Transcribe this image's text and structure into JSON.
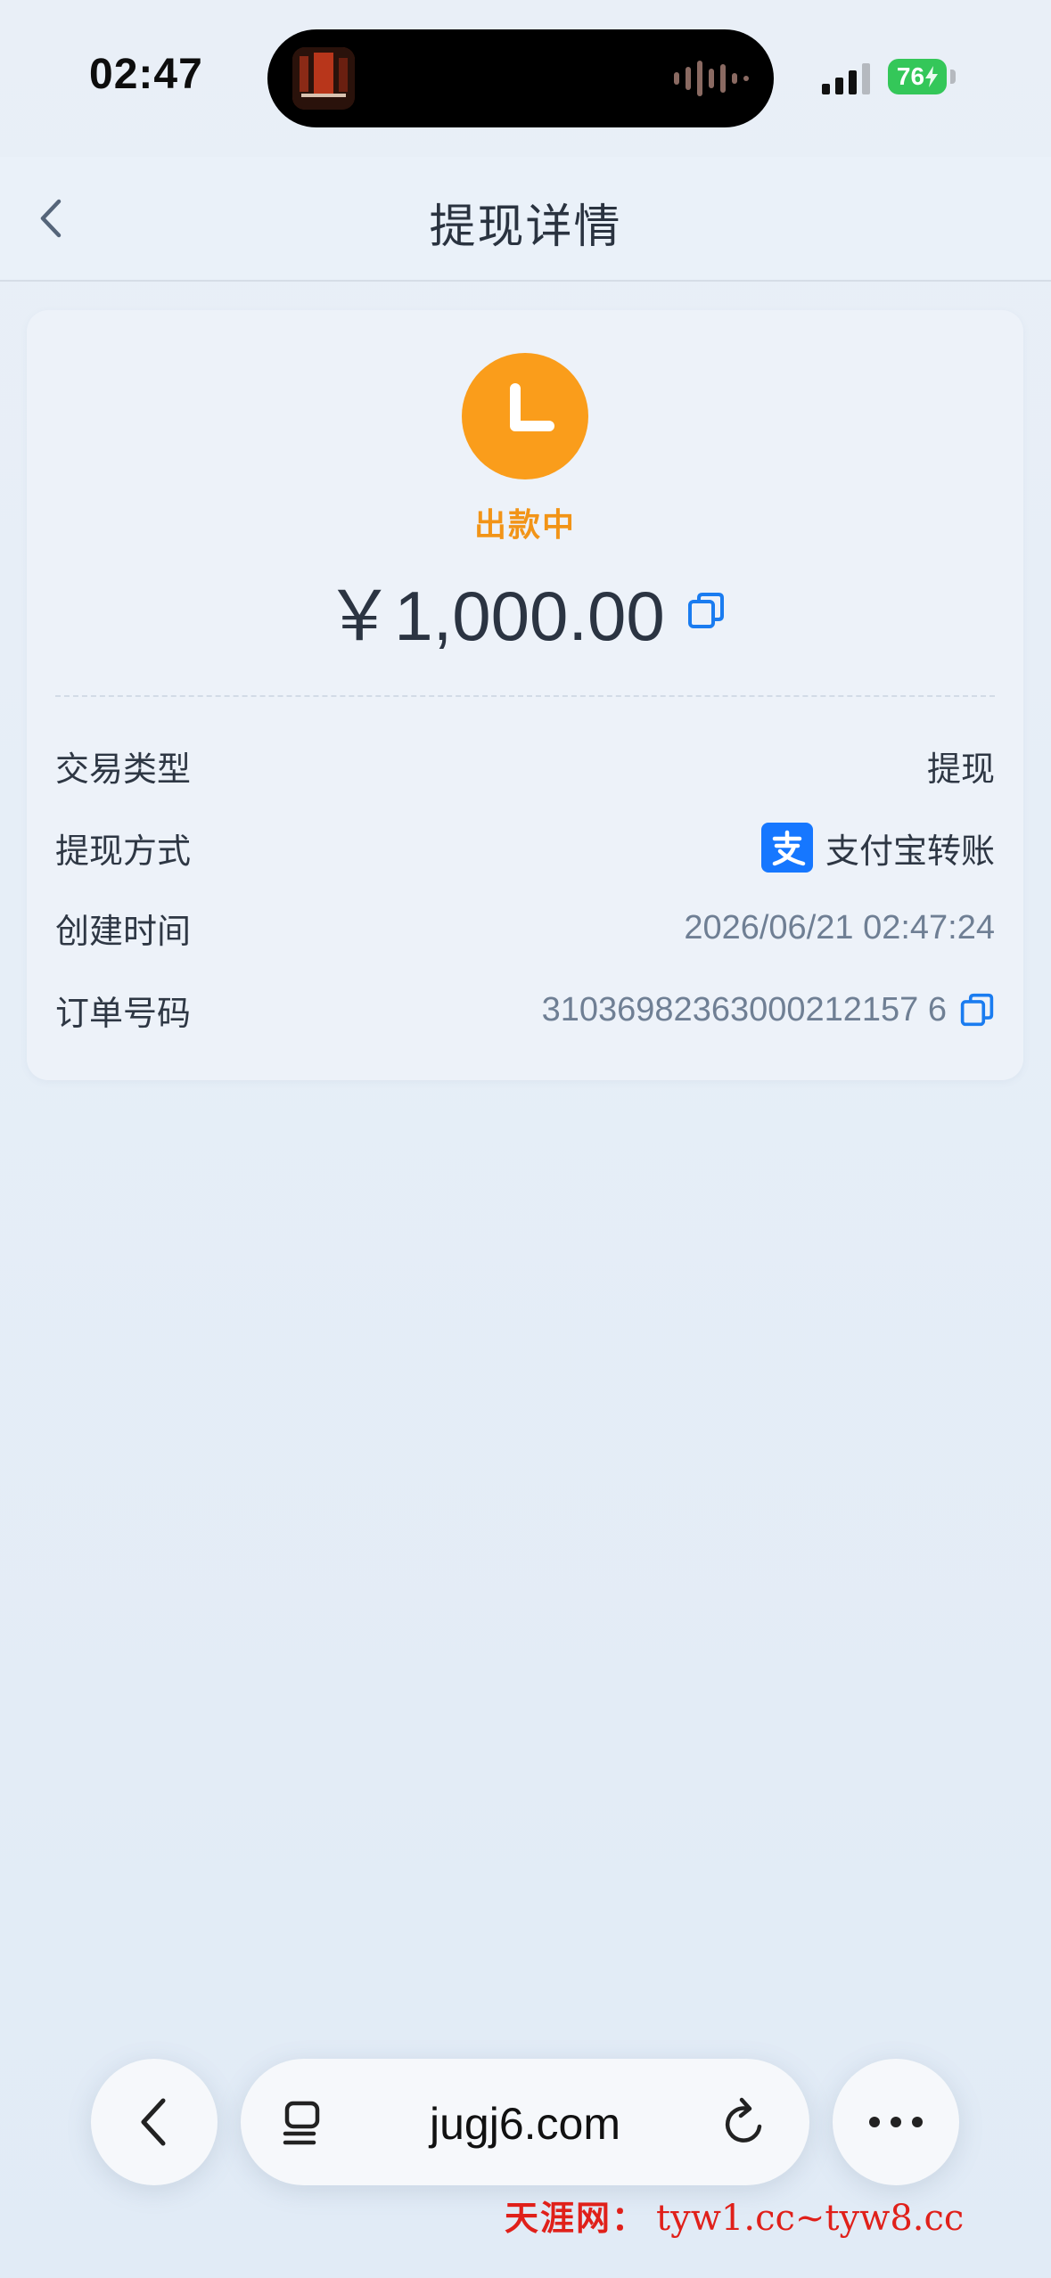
{
  "status_bar": {
    "time": "02:47",
    "battery": "76",
    "icons": [
      "now-playing-thumbnail",
      "audio-waveform-icon",
      "cellular-signal-icon",
      "battery-charging-icon"
    ]
  },
  "nav": {
    "title": "提现详情",
    "back_icon": "chevron-left-icon"
  },
  "status": {
    "label": "出款中",
    "icon": "clock-icon",
    "color": "#FA9D1B"
  },
  "amount": "￥1,000.00",
  "details": [
    {
      "label": "交易类型",
      "value": "提现"
    },
    {
      "label": "提现方式",
      "value": "支付宝转账",
      "icon": "alipay-icon"
    },
    {
      "label": "创建时间",
      "value": "2026/06/21 02:47:24"
    },
    {
      "label": "订单号码",
      "value": "31036982363000212157 6",
      "copyable": true
    }
  ],
  "browser_bar": {
    "url": "jugj6.com",
    "icons": [
      "chevron-left-icon",
      "tabs-icon",
      "reload-icon",
      "more-icon"
    ]
  },
  "watermark": {
    "name": "天涯网：",
    "sites": "tyw1.cc~tyw8.cc"
  },
  "colors": {
    "accent_orange": "#FA9D1B",
    "copy_blue": "#1A7CF0",
    "alipay_blue": "#1677FF",
    "battery_green": "#34C759",
    "watermark_red": "#E0201A"
  }
}
